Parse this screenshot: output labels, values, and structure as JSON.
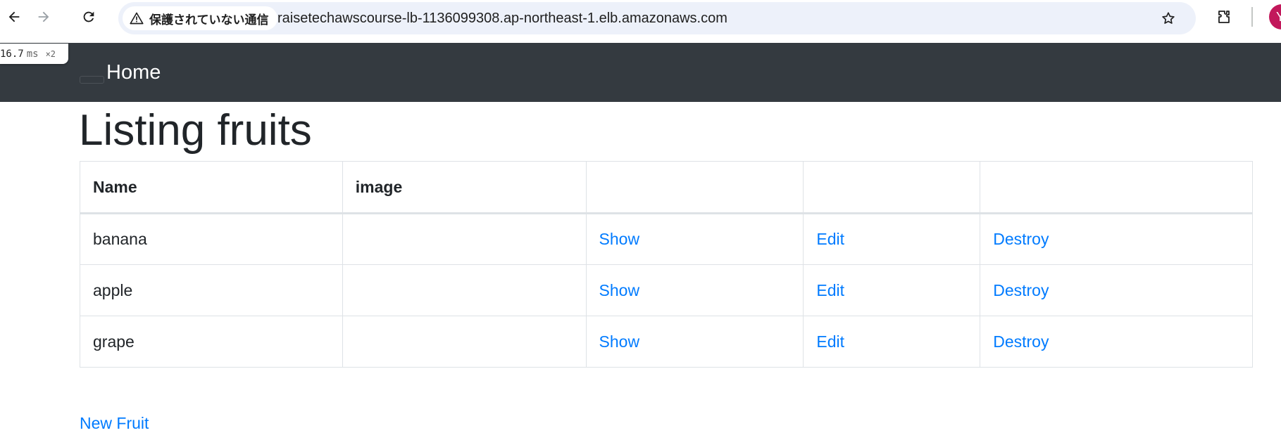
{
  "browser": {
    "security_label": "保護されていない通信",
    "url": "raisetechawscourse-lb-1136099308.ap-northeast-1.elb.amazonaws.com",
    "profile_initial": "Y"
  },
  "perf_badge": {
    "value": "16.7",
    "unit": "ms",
    "multiplier": "×2"
  },
  "navbar": {
    "home_label": "Home"
  },
  "page": {
    "title": "Listing fruits"
  },
  "table": {
    "headers": [
      "Name",
      "image",
      "",
      "",
      ""
    ],
    "rows": [
      {
        "name": "banana",
        "image": "",
        "show": "Show",
        "edit": "Edit",
        "destroy": "Destroy"
      },
      {
        "name": "apple",
        "image": "",
        "show": "Show",
        "edit": "Edit",
        "destroy": "Destroy"
      },
      {
        "name": "grape",
        "image": "",
        "show": "Show",
        "edit": "Edit",
        "destroy": "Destroy"
      }
    ]
  },
  "new_link": "New Fruit",
  "colors": {
    "navbar": "#343a40",
    "link": "#007bff",
    "text": "#212529",
    "border": "#dee2e6",
    "avatar": "#c2185b"
  }
}
